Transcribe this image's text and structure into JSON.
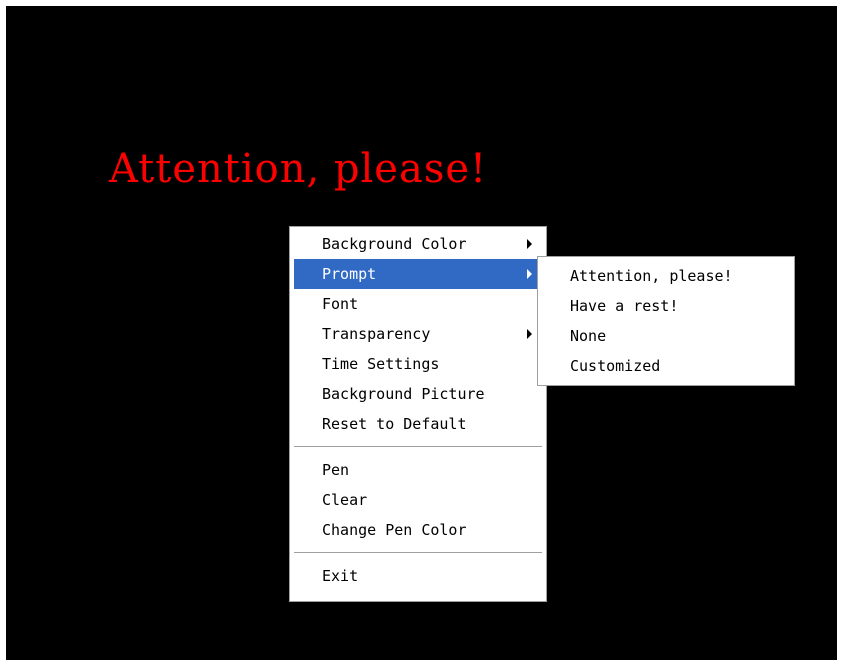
{
  "prompt": {
    "text": "Attention, please!",
    "color": "#ff0000"
  },
  "context_menu": {
    "group1": [
      {
        "label": "Background Color",
        "has_submenu": true,
        "active": false
      },
      {
        "label": "Prompt",
        "has_submenu": true,
        "active": true
      },
      {
        "label": "Font",
        "has_submenu": false,
        "active": false
      },
      {
        "label": "Transparency",
        "has_submenu": true,
        "active": false
      },
      {
        "label": "Time Settings",
        "has_submenu": false,
        "active": false
      },
      {
        "label": "Background Picture",
        "has_submenu": false,
        "active": false
      },
      {
        "label": "Reset to Default",
        "has_submenu": false,
        "active": false
      }
    ],
    "group2": [
      {
        "label": "Pen"
      },
      {
        "label": "Clear"
      },
      {
        "label": "Change Pen Color"
      }
    ],
    "group3": [
      {
        "label": "Exit"
      }
    ]
  },
  "prompt_submenu": {
    "items": [
      {
        "label": "Attention, please!"
      },
      {
        "label": "Have a rest!"
      },
      {
        "label": "None"
      },
      {
        "label": "Customized"
      }
    ]
  },
  "colors": {
    "background": "#000000",
    "menu_background": "#ffffff",
    "highlight": "#316ac5"
  },
  "icons": {
    "submenu_arrow": "submenu-arrow-icon"
  }
}
